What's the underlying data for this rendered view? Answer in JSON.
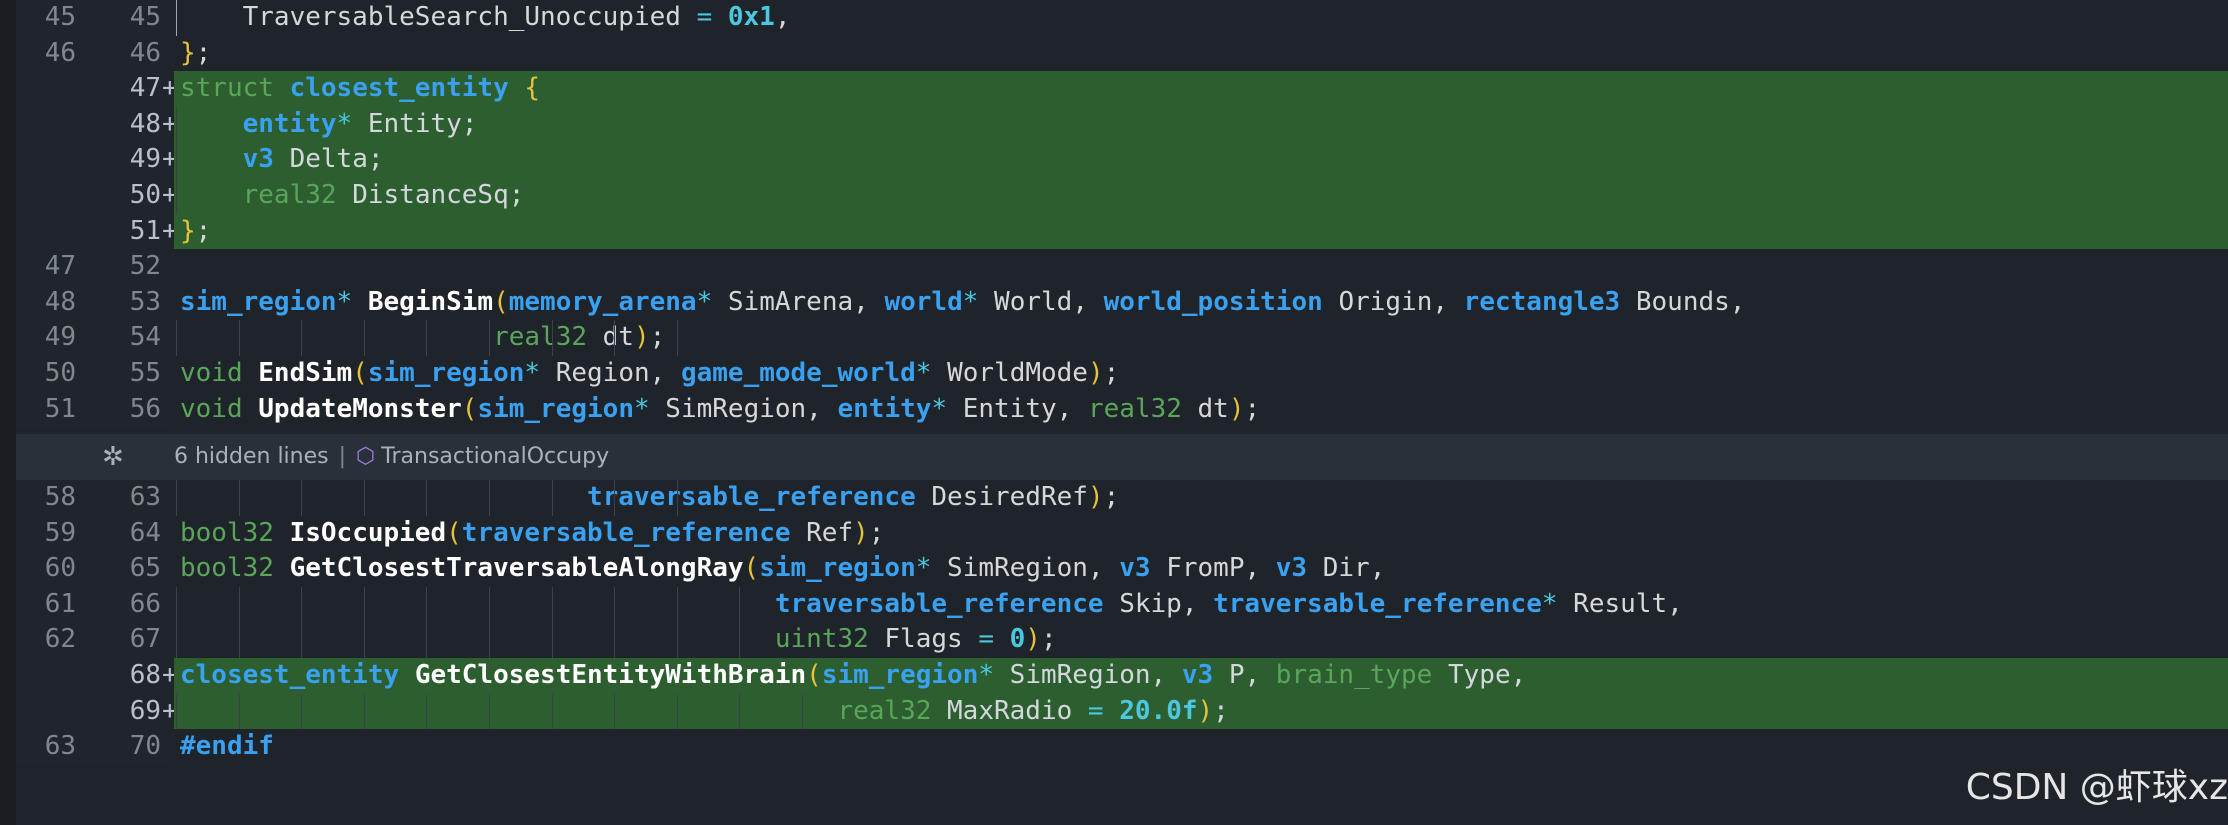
{
  "rows": [
    {
      "old": "45",
      "new": "45",
      "added": false,
      "guides": [
        {
          "c": 0,
          "a": true
        }
      ],
      "tokens": [
        [
          "    TraversableSearch_Unoccupied ",
          "pl"
        ],
        [
          "= ",
          "op"
        ],
        [
          "0x1",
          "num"
        ],
        [
          ",",
          "pl"
        ]
      ]
    },
    {
      "old": "46",
      "new": "46",
      "added": false,
      "guides": [],
      "tokens": [
        [
          "}",
          "pun"
        ],
        [
          ";",
          "pl"
        ]
      ]
    },
    {
      "old": "",
      "new": "47",
      "added": true,
      "guides": [],
      "tokens": [
        [
          "struct ",
          "kw"
        ],
        [
          "closest_entity ",
          "ty"
        ],
        [
          "{",
          "pun"
        ]
      ]
    },
    {
      "old": "",
      "new": "48",
      "added": true,
      "guides": [
        {
          "c": 0,
          "a": false
        }
      ],
      "tokens": [
        [
          "    ",
          "pl"
        ],
        [
          "entity",
          "ty"
        ],
        [
          "* ",
          "op"
        ],
        [
          "Entity;",
          "pl"
        ]
      ]
    },
    {
      "old": "",
      "new": "49",
      "added": true,
      "guides": [
        {
          "c": 0,
          "a": false
        }
      ],
      "tokens": [
        [
          "    ",
          "pl"
        ],
        [
          "v3 ",
          "ty"
        ],
        [
          "Delta;",
          "pl"
        ]
      ]
    },
    {
      "old": "",
      "new": "50",
      "added": true,
      "guides": [
        {
          "c": 0,
          "a": false
        }
      ],
      "tokens": [
        [
          "    ",
          "pl"
        ],
        [
          "real32 ",
          "kw"
        ],
        [
          "DistanceSq;",
          "pl"
        ]
      ]
    },
    {
      "old": "",
      "new": "51",
      "added": true,
      "guides": [],
      "tokens": [
        [
          "}",
          "pun"
        ],
        [
          ";",
          "pl"
        ]
      ]
    },
    {
      "old": "47",
      "new": "52",
      "added": false,
      "guides": [],
      "tokens": []
    },
    {
      "old": "48",
      "new": "53",
      "added": false,
      "guides": [],
      "tokens": [
        [
          "sim_region",
          "ty"
        ],
        [
          "* ",
          "op"
        ],
        [
          "BeginSim",
          "fn"
        ],
        [
          "(",
          "pun"
        ],
        [
          "memory_arena",
          "ty"
        ],
        [
          "* ",
          "op"
        ],
        [
          "SimArena, ",
          "pl"
        ],
        [
          "world",
          "ty"
        ],
        [
          "* ",
          "op"
        ],
        [
          "World, ",
          "pl"
        ],
        [
          "world_position ",
          "ty"
        ],
        [
          "Origin, ",
          "pl"
        ],
        [
          "rectangle3 ",
          "ty"
        ],
        [
          "Bounds,",
          "pl"
        ]
      ]
    },
    {
      "old": "49",
      "new": "54",
      "added": false,
      "guides": [
        {
          "c": 0,
          "a": false
        },
        {
          "c": 4,
          "a": false
        },
        {
          "c": 8,
          "a": false
        },
        {
          "c": 12,
          "a": false
        },
        {
          "c": 16,
          "a": false
        },
        {
          "c": 20,
          "a": false
        },
        {
          "c": 24,
          "a": false
        },
        {
          "c": 28,
          "a": false
        },
        {
          "c": 32,
          "a": false
        }
      ],
      "tokens": [
        [
          "                    ",
          "pl"
        ],
        [
          "real32 ",
          "kw"
        ],
        [
          "dt",
          "pl"
        ],
        [
          ")",
          "pun"
        ],
        [
          ";",
          "pl"
        ]
      ]
    },
    {
      "old": "50",
      "new": "55",
      "added": false,
      "guides": [],
      "tokens": [
        [
          "void ",
          "kw"
        ],
        [
          "EndSim",
          "fn"
        ],
        [
          "(",
          "pun"
        ],
        [
          "sim_region",
          "ty"
        ],
        [
          "* ",
          "op"
        ],
        [
          "Region, ",
          "pl"
        ],
        [
          "game_mode_world",
          "ty"
        ],
        [
          "* ",
          "op"
        ],
        [
          "WorldMode",
          "pl"
        ],
        [
          ")",
          "pun"
        ],
        [
          ";",
          "pl"
        ]
      ]
    },
    {
      "old": "51",
      "new": "56",
      "added": false,
      "guides": [],
      "tokens": [
        [
          "void ",
          "kw"
        ],
        [
          "UpdateMonster",
          "fn"
        ],
        [
          "(",
          "pun"
        ],
        [
          "sim_region",
          "ty"
        ],
        [
          "* ",
          "op"
        ],
        [
          "SimRegion, ",
          "pl"
        ],
        [
          "entity",
          "ty"
        ],
        [
          "* ",
          "op"
        ],
        [
          "Entity, ",
          "pl"
        ],
        [
          "real32 ",
          "kw"
        ],
        [
          "dt",
          "pl"
        ],
        [
          ")",
          "pun"
        ],
        [
          ";",
          "pl"
        ]
      ]
    },
    {
      "old": "58",
      "new": "63",
      "added": false,
      "guides": [
        {
          "c": 0,
          "a": false
        },
        {
          "c": 4,
          "a": false
        },
        {
          "c": 8,
          "a": false
        },
        {
          "c": 12,
          "a": false
        },
        {
          "c": 16,
          "a": false
        },
        {
          "c": 20,
          "a": false
        },
        {
          "c": 24,
          "a": false
        },
        {
          "c": 28,
          "a": false
        },
        {
          "c": 32,
          "a": false
        }
      ],
      "tokens": [
        [
          "                          ",
          "pl"
        ],
        [
          "traversable_reference ",
          "ty"
        ],
        [
          "DesiredRef",
          "pl"
        ],
        [
          ")",
          "pun"
        ],
        [
          ";",
          "pl"
        ]
      ]
    },
    {
      "old": "59",
      "new": "64",
      "added": false,
      "guides": [],
      "tokens": [
        [
          "bool32 ",
          "kw"
        ],
        [
          "IsOccupied",
          "fn"
        ],
        [
          "(",
          "pun"
        ],
        [
          "traversable_reference ",
          "ty"
        ],
        [
          "Ref",
          "pl"
        ],
        [
          ")",
          "pun"
        ],
        [
          ";",
          "pl"
        ]
      ]
    },
    {
      "old": "60",
      "new": "65",
      "added": false,
      "guides": [],
      "tokens": [
        [
          "bool32 ",
          "kw"
        ],
        [
          "GetClosestTraversableAlongRay",
          "fn"
        ],
        [
          "(",
          "pun"
        ],
        [
          "sim_region",
          "ty"
        ],
        [
          "* ",
          "op"
        ],
        [
          "SimRegion, ",
          "pl"
        ],
        [
          "v3 ",
          "ty"
        ],
        [
          "FromP, ",
          "pl"
        ],
        [
          "v3 ",
          "ty"
        ],
        [
          "Dir,",
          "pl"
        ]
      ]
    },
    {
      "old": "61",
      "new": "66",
      "added": false,
      "guides": [
        {
          "c": 0,
          "a": false
        },
        {
          "c": 4,
          "a": false
        },
        {
          "c": 8,
          "a": false
        },
        {
          "c": 12,
          "a": false
        },
        {
          "c": 16,
          "a": false
        },
        {
          "c": 20,
          "a": false
        },
        {
          "c": 24,
          "a": false
        },
        {
          "c": 28,
          "a": false
        },
        {
          "c": 32,
          "a": false
        },
        {
          "c": 36,
          "a": false
        }
      ],
      "tokens": [
        [
          "                                      ",
          "pl"
        ],
        [
          "traversable_reference ",
          "ty"
        ],
        [
          "Skip, ",
          "pl"
        ],
        [
          "traversable_reference",
          "ty"
        ],
        [
          "* ",
          "op"
        ],
        [
          "Result,",
          "pl"
        ]
      ]
    },
    {
      "old": "62",
      "new": "67",
      "added": false,
      "guides": [
        {
          "c": 0,
          "a": false
        },
        {
          "c": 4,
          "a": false
        },
        {
          "c": 8,
          "a": false
        },
        {
          "c": 12,
          "a": false
        },
        {
          "c": 16,
          "a": false
        },
        {
          "c": 20,
          "a": false
        },
        {
          "c": 24,
          "a": false
        },
        {
          "c": 28,
          "a": false
        },
        {
          "c": 32,
          "a": false
        },
        {
          "c": 36,
          "a": false
        }
      ],
      "tokens": [
        [
          "                                      ",
          "pl"
        ],
        [
          "uint32 ",
          "kw"
        ],
        [
          "Flags ",
          "pl"
        ],
        [
          "= ",
          "op"
        ],
        [
          "0",
          "num"
        ],
        [
          ")",
          "pun"
        ],
        [
          ";",
          "pl"
        ]
      ]
    },
    {
      "old": "",
      "new": "68",
      "added": true,
      "guides": [],
      "tokens": [
        [
          "closest_entity ",
          "ty"
        ],
        [
          "GetClosestEntityWithBrain",
          "fn"
        ],
        [
          "(",
          "pun"
        ],
        [
          "sim_region",
          "ty"
        ],
        [
          "* ",
          "op"
        ],
        [
          "SimRegion, ",
          "pl"
        ],
        [
          "v3 ",
          "ty"
        ],
        [
          "P, ",
          "pl"
        ],
        [
          "brain_type ",
          "kw"
        ],
        [
          "Type,",
          "pl"
        ]
      ]
    },
    {
      "old": "",
      "new": "69",
      "added": true,
      "guides": [
        {
          "c": 0,
          "a": false
        },
        {
          "c": 4,
          "a": false
        },
        {
          "c": 8,
          "a": false
        },
        {
          "c": 12,
          "a": false
        },
        {
          "c": 16,
          "a": false
        },
        {
          "c": 20,
          "a": false
        },
        {
          "c": 24,
          "a": false
        },
        {
          "c": 28,
          "a": false
        },
        {
          "c": 32,
          "a": false
        },
        {
          "c": 36,
          "a": false
        },
        {
          "c": 40,
          "a": false
        }
      ],
      "tokens": [
        [
          "                                          ",
          "pl"
        ],
        [
          "real32 ",
          "kw"
        ],
        [
          "MaxRadio ",
          "pl"
        ],
        [
          "= ",
          "op"
        ],
        [
          "20.0f",
          "num"
        ],
        [
          ")",
          "pun"
        ],
        [
          ";",
          "pl"
        ]
      ]
    },
    {
      "old": "63",
      "new": "70",
      "added": false,
      "guides": [],
      "tokens": [
        [
          "#endif",
          "pp"
        ]
      ]
    }
  ],
  "fold": {
    "label": "6 hidden lines",
    "separator": "|",
    "symbol": "TransactionalOccupy",
    "icon": "fold-icon",
    "symbol_icon": "cube-icon"
  },
  "watermark": "CSDN @虾球xz"
}
